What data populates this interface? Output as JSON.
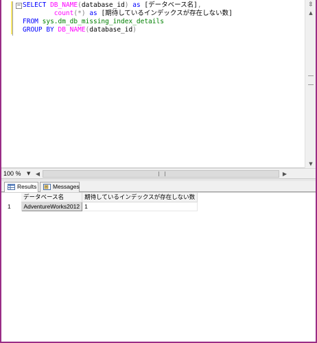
{
  "editor": {
    "line1": {
      "kw_select": "SELECT",
      "fn_dbname": "DB_NAME",
      "paren_open": "(",
      "arg": "database_id",
      "paren_close": ")",
      "kw_as": "as",
      "alias": "[データベース名]",
      "comma": ","
    },
    "line2": {
      "fn_count": "count",
      "paren_open": "(",
      "star": "*",
      "paren_close": ")",
      "kw_as": "as",
      "alias": "[期待しているインデックスが存在しない数]"
    },
    "line3": {
      "kw_from": "FROM",
      "obj": "sys.dm_db_missing_index_details"
    },
    "line4": {
      "kw_group": "GROUP BY",
      "fn_dbname": "DB_NAME",
      "paren_open": "(",
      "arg": "database_id",
      "paren_close": ")"
    }
  },
  "status": {
    "zoom": "100 %"
  },
  "tabs": [
    {
      "label": "Results",
      "icon": "grid-icon",
      "active": true
    },
    {
      "label": "Messages",
      "icon": "messages-icon",
      "active": false
    }
  ],
  "results": {
    "columns": [
      "データベース名",
      "期待しているインデックスが存在しない数"
    ],
    "rows": [
      {
        "rownum": "1",
        "cells": [
          "AdventureWorks2012",
          "1"
        ]
      }
    ]
  },
  "colors": {
    "frame": "#9a2d86",
    "keyword": "#0000ff",
    "function": "#ff00ff",
    "object": "#008000",
    "operator": "#808080"
  }
}
